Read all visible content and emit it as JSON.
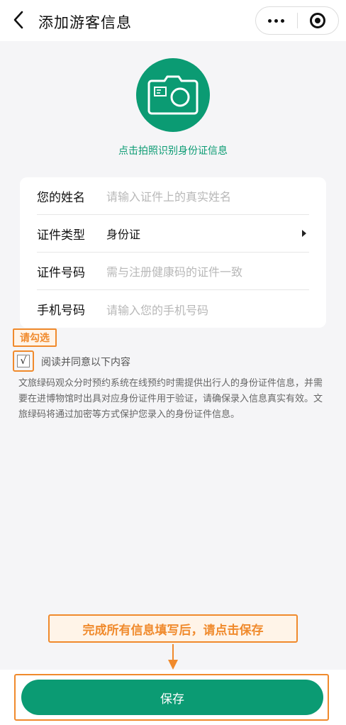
{
  "nav": {
    "title": "添加游客信息",
    "icons": {
      "back": "back-arrow-icon",
      "more": "more-dots-icon",
      "close": "target-close-icon"
    }
  },
  "camera": {
    "icon": "camera-icon",
    "hint": "点击拍照识别身份证信息"
  },
  "form": {
    "rows": [
      {
        "label": "您的姓名",
        "placeholder": "请输入证件上的真实姓名"
      },
      {
        "label": "证件类型",
        "value": "身份证",
        "icon": "caret-right-icon"
      },
      {
        "label": "证件号码",
        "placeholder": "需与注册健康码的证件一致"
      },
      {
        "label": "手机号码",
        "placeholder": "请输入您的手机号码"
      }
    ]
  },
  "agreement": {
    "callout": "请勾选",
    "check_mark": "√",
    "label": "阅读并同意以下内容",
    "notice": "文旅绿码观众分时预约系统在线预约时需提供出行人的身份证件信息，并需要在进博物馆时出具对应身份证件用于验证，请确保录入信息真实有效。文旅绿码将通过加密等方式保护您录入的身份证件信息。"
  },
  "bottom": {
    "callout": "完成所有信息填写后，请点击保存",
    "save_label": "保存"
  },
  "colors": {
    "primary": "#0b9b73",
    "annotation": "#f08a2c",
    "background": "#f5f5f7"
  }
}
